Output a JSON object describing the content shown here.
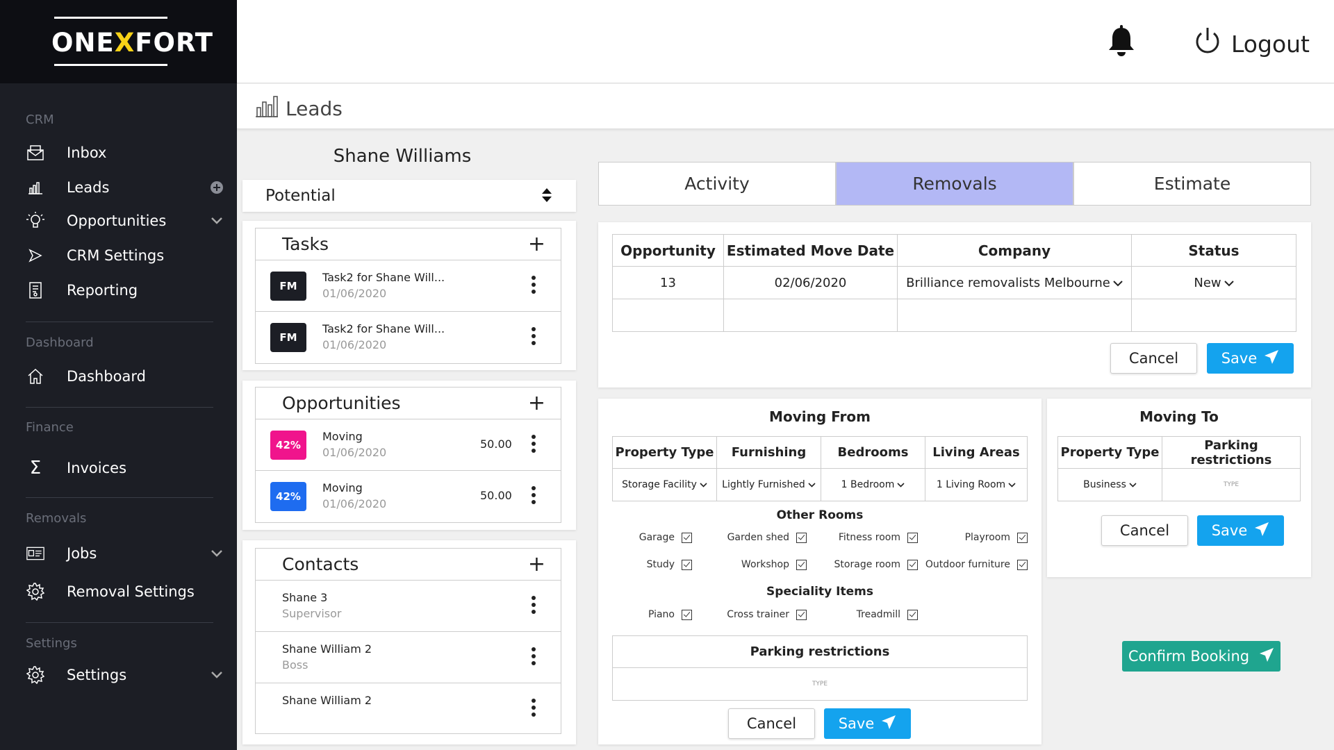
{
  "brand": {
    "name_pre": "ONE",
    "name_x": "X",
    "name_post": "FORT",
    "accent": "#f7d117"
  },
  "sidebar": {
    "crm_label": "CRM",
    "inbox": "Inbox",
    "leads": "Leads",
    "opportunities": "Opportunities",
    "crm_settings": "CRM Settings",
    "reporting": "Reporting",
    "dashboard_label": "Dashboard",
    "dashboard": "Dashboard",
    "finance_label": "Finance",
    "invoices": "Invoices",
    "removals_label": "Removals",
    "jobs": "Jobs",
    "removal_settings": "Removal Settings",
    "settings_label": "Settings",
    "settings": "Settings"
  },
  "header": {
    "logout": "Logout"
  },
  "breadcrumb": {
    "title": "Leads"
  },
  "lead": {
    "name": "Shane Williams",
    "stage": "Potential"
  },
  "tasks": {
    "title": "Tasks",
    "items": [
      {
        "badge": "FM",
        "title": "Task2 for Shane Will...",
        "date": "01/06/2020"
      },
      {
        "badge": "FM",
        "title": "Task2 for Shane Will...",
        "date": "01/06/2020"
      }
    ]
  },
  "opportunities": {
    "title": "Opportunities",
    "items": [
      {
        "badge": "42%",
        "color": "#f0148c",
        "title": "Moving",
        "date": "01/06/2020",
        "amount": "50.00"
      },
      {
        "badge": "42%",
        "color": "#1e6cf0",
        "title": "Moving",
        "date": "01/06/2020",
        "amount": "50.00"
      }
    ]
  },
  "contacts": {
    "title": "Contacts",
    "items": [
      {
        "name": "Shane 3",
        "role": "Supervisor"
      },
      {
        "name": "Shane William 2",
        "role": "Boss"
      },
      {
        "name": "Shane William 2",
        "role": ""
      }
    ]
  },
  "tabs": [
    "Activity",
    "Removals",
    "Estimate"
  ],
  "opp_table": {
    "headers": [
      "Opportunity",
      "Estimated Move Date",
      "Company",
      "Status"
    ],
    "row": {
      "opportunity": "13",
      "date": "02/06/2020",
      "company": "Brilliance removalists Melbourne",
      "status": "New"
    }
  },
  "buttons": {
    "cancel": "Cancel",
    "save": "Save",
    "confirm": "Confirm Booking"
  },
  "moving_from": {
    "title": "Moving From",
    "headers": [
      "Property Type",
      "Furnishing",
      "Bedrooms",
      "Living Areas"
    ],
    "values": [
      "Storage Facility",
      "Lightly Furnished",
      "1 Bedroom",
      "1 Living Room"
    ],
    "other_rooms_title": "Other Rooms",
    "rooms": [
      "Garage",
      "Garden shed",
      "Fitness room",
      "Playroom",
      "Study",
      "Workshop",
      "Storage room",
      "Outdoor furniture"
    ],
    "speciality_title": "Speciality Items",
    "speciality": [
      "Piano",
      "Cross trainer",
      "Treadmill"
    ],
    "parking_title": "Parking restrictions",
    "parking_placeholder": "TYPE"
  },
  "moving_to": {
    "title": "Moving To",
    "headers": [
      "Property Type",
      "Parking restrictions"
    ],
    "property_value": "Business",
    "parking_placeholder": "TYPE"
  },
  "colors": {
    "sidebar": "#1c1e25",
    "active_tab": "#b3b8f5",
    "save": "#14a3ee",
    "confirm": "#1fa58f"
  }
}
